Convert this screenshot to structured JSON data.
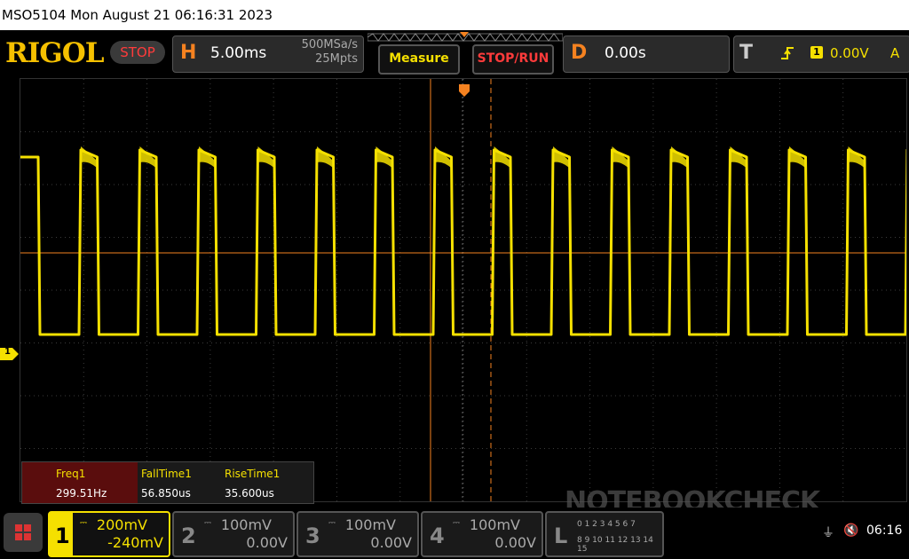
{
  "title_bar": {
    "text": "MSO5104  Mon August 21 06:16:31 2023"
  },
  "brand": {
    "logo": "RIGOL",
    "state": "STOP"
  },
  "horizontal": {
    "letter": "H",
    "timebase": "5.00ms",
    "sample_rate": "500MSa/s",
    "memory_depth": "25Mpts"
  },
  "buttons": {
    "measure": "Measure",
    "stop_run": "STOP/RUN"
  },
  "delay": {
    "letter": "D",
    "value": "0.00s"
  },
  "trigger": {
    "letter": "T",
    "source": "1",
    "level": "0.00V",
    "mode": "A"
  },
  "measurements": {
    "headers": [
      "Freq1",
      "FallTime1",
      "RiseTime1"
    ],
    "values": [
      "299.51Hz",
      "56.850us",
      "35.600us"
    ]
  },
  "channels": [
    {
      "num": "1",
      "scale": "200mV",
      "offset": "-240mV",
      "active": true,
      "color": "#f5e000"
    },
    {
      "num": "2",
      "scale": "100mV",
      "offset": "0.00V",
      "active": false,
      "color": "#888888"
    },
    {
      "num": "3",
      "scale": "100mV",
      "offset": "0.00V",
      "active": false,
      "color": "#888888"
    },
    {
      "num": "4",
      "scale": "100mV",
      "offset": "0.00V",
      "active": false,
      "color": "#888888"
    }
  ],
  "logic": {
    "letter": "L",
    "row1": "0 1 2 3 4 5 6 7",
    "row2": "8 9 10 11 12 13 14 15"
  },
  "status": {
    "time": "06:16"
  },
  "marker": {
    "ch1": "1"
  },
  "watermark": "NOTEBOOKCHECK",
  "colors": {
    "ch1": "#f5e000",
    "accent": "#f58220",
    "stop": "#ff3b3b"
  }
}
